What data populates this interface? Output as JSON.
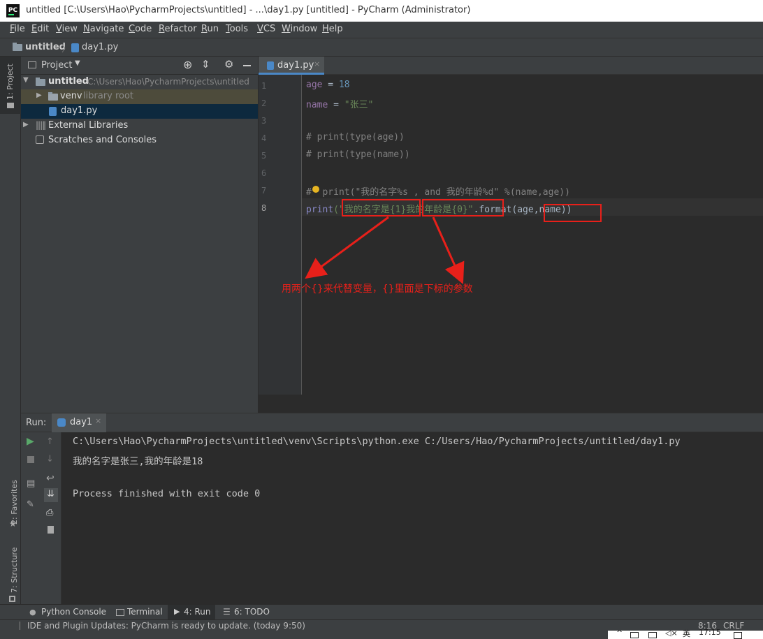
{
  "window": {
    "title": "untitled [C:\\Users\\Hao\\PycharmProjects\\untitled] - ...\\day1.py [untitled] - PyCharm (Administrator)",
    "logo_text": "PC"
  },
  "menu": [
    "File",
    "Edit",
    "View",
    "Navigate",
    "Code",
    "Refactor",
    "Run",
    "Tools",
    "VCS",
    "Window",
    "Help"
  ],
  "breadcrumb": {
    "project": "untitled",
    "file": "day1.py"
  },
  "left_strip": {
    "project_tab": "1: Project",
    "favorites_tab": "2: Favorites",
    "structure_tab": "7: Structure"
  },
  "project_panel": {
    "title": "Project",
    "tree": [
      {
        "label": "untitled",
        "hint": "C:\\Users\\Hao\\PycharmProjects\\untitled"
      },
      {
        "label": "venv",
        "hint": "library root"
      },
      {
        "label": "day1.py",
        "hint": ""
      },
      {
        "label": "External Libraries",
        "hint": ""
      },
      {
        "label": "Scratches and Consoles",
        "hint": ""
      }
    ]
  },
  "editor": {
    "tab": "day1.py",
    "line_numbers": [
      "1",
      "2",
      "3",
      "4",
      "5",
      "6",
      "7",
      "8"
    ],
    "lines": {
      "l1_var": "age",
      "l1_op": " = ",
      "l1_val": "18",
      "l2_var": "name",
      "l2_op": " = ",
      "l2_val": "\"张三\"",
      "l4": "# print(type(age))",
      "l5": "# print(type(name))",
      "l7": "#  print(\"我的名字%s , and 我的年龄%d\" %(name,age))",
      "l8_fn": "print",
      "l8_open": "(\"",
      "l8_s1": "我的名字是{1}",
      "l8_s2": "我的年龄是{0}",
      "l8_close": "\"",
      "l8_fmt": ".format(",
      "l8_args": "age,name",
      "l8_end": "))"
    }
  },
  "annotation": {
    "text": "用两个{}来代替变量，{}里面是下标的参数",
    "color": "#e8201a"
  },
  "run_panel": {
    "label": "Run:",
    "tab": "day1",
    "output": [
      "C:\\Users\\Hao\\PycharmProjects\\untitled\\venv\\Scripts\\python.exe C:/Users/Hao/PycharmProjects/untitled/day1.py",
      "我的名字是张三,我的年龄是18",
      "",
      "Process finished with exit code 0"
    ]
  },
  "bottom_tabs": [
    "Python Console",
    "Terminal",
    "4: Run",
    "6: TODO"
  ],
  "status": {
    "message": "IDE and Plugin Updates: PyCharm is ready to update. (today 9:50)",
    "position": "8:16",
    "line_sep": "CRLF",
    "clock": "17:15",
    "ime": "英"
  }
}
